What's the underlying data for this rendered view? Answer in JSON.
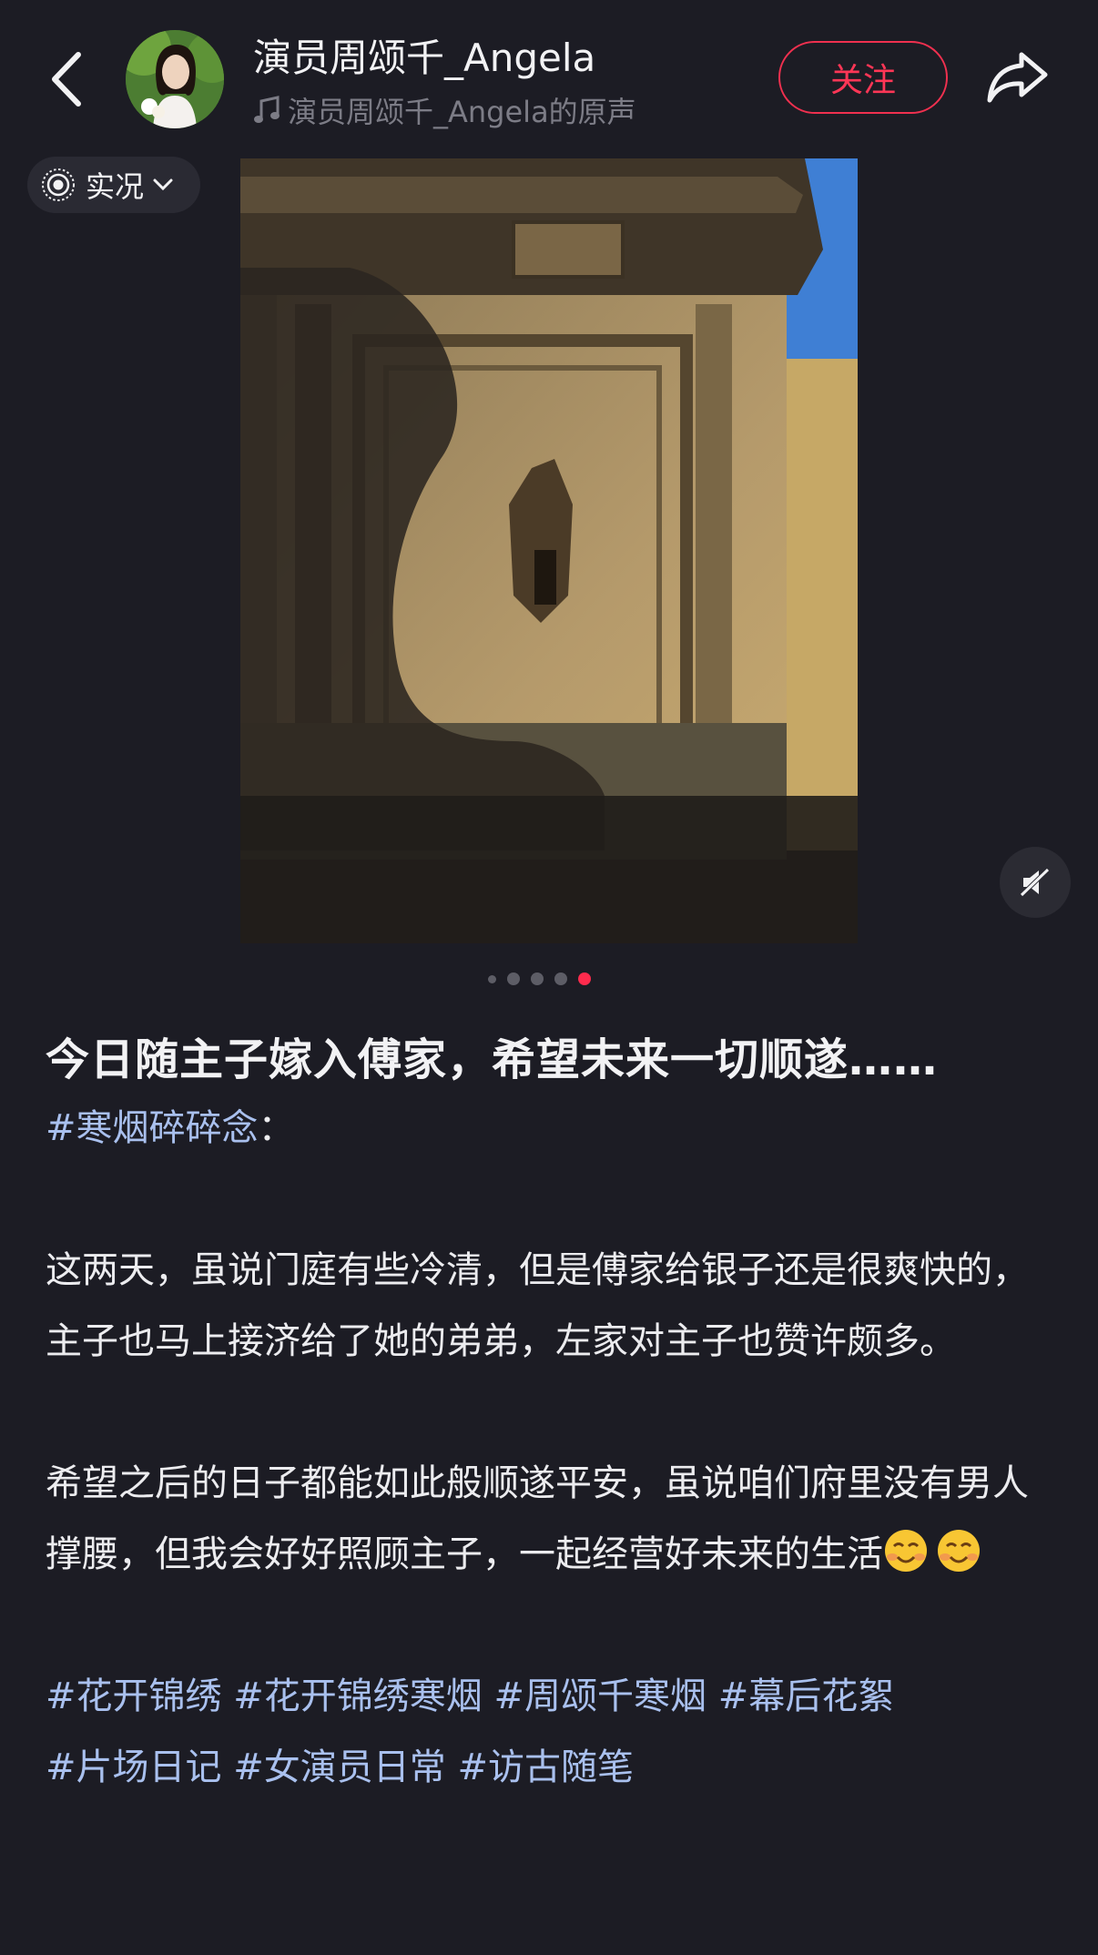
{
  "header": {
    "author_name": "演员周颂千_Angela",
    "sound_label": "演员周颂千_Angela的原声",
    "follow_label": "关注"
  },
  "live_badge": {
    "label": "实况"
  },
  "carousel": {
    "total": 5,
    "active_index": 5
  },
  "post": {
    "title": "今日随主子嫁入傅家，希望未来一切顺遂……",
    "topic_tag": "#寒烟碎碎念",
    "topic_suffix": "：",
    "paragraph1": "这两天，虽说门庭有些冷清，但是傅家给银子还是很爽快的，主子也马上接济给了她的弟弟，左家对主子也赞许颇多。",
    "paragraph2": "希望之后的日子都能如此般顺遂平安，虽说咱们府里没有男人撑腰，但我会好好照顾主子，一起经营好未来的生活",
    "emoji": [
      "smiling-face-emoji",
      "smiling-face-emoji"
    ],
    "tags": [
      "#花开锦绣",
      "#花开锦绣寒烟",
      "#周颂千寒烟",
      "#幕后花絮",
      "#片场日记",
      "#女演员日常",
      "#访古随笔"
    ]
  },
  "colors": {
    "background": "#1c1c24",
    "accent": "#ff2b4d",
    "tag": "#a9c0ee"
  }
}
